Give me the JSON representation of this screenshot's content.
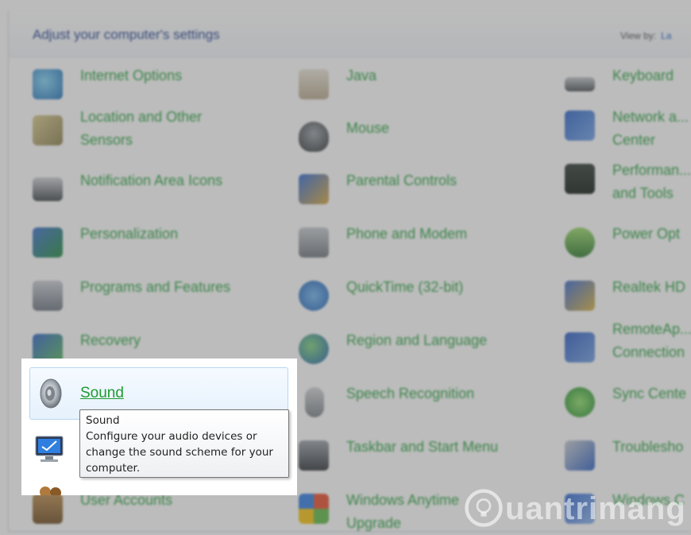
{
  "header": {
    "title": "Adjust your computer's settings",
    "view_by_label": "View by:",
    "view_by_value": "La"
  },
  "items": {
    "internet_options": "Internet Options",
    "java": "Java",
    "keyboard": "Keyboard",
    "location_sensors": "Location and Other Sensors",
    "mouse": "Mouse",
    "network_center": "Network a... Center",
    "notification_icons": "Notification Area Icons",
    "parental_controls": "Parental Controls",
    "performance_tools": "Performan... and Tools",
    "personalization": "Personalization",
    "phone_modem": "Phone and Modem",
    "power_options": "Power Opt",
    "programs_features": "Programs and Features",
    "quicktime": "QuickTime (32-bit)",
    "realtek": "Realtek HD",
    "recovery": "Recovery",
    "region_language": "Region and Language",
    "remoteapp": "RemoteAp... Connection",
    "sound": "Sound",
    "speech_recognition": "Speech Recognition",
    "sync_center": "Sync Cente",
    "taskbar_start": "Taskbar and Start Menu",
    "troubleshoot": "Troublesho",
    "user_accounts": "User Accounts",
    "windows_anytime": "Windows Anytime Upgrade",
    "windows_other": "Windows C"
  },
  "tooltip": {
    "title": "Sound",
    "description": "Configure your audio devices or change the sound scheme for your computer."
  },
  "watermark": {
    "text": "uantrimang"
  },
  "colors": {
    "link_green": "#23a03a",
    "title_blue": "#1e3f8f",
    "dim_overlay": "#5f5f5f"
  }
}
